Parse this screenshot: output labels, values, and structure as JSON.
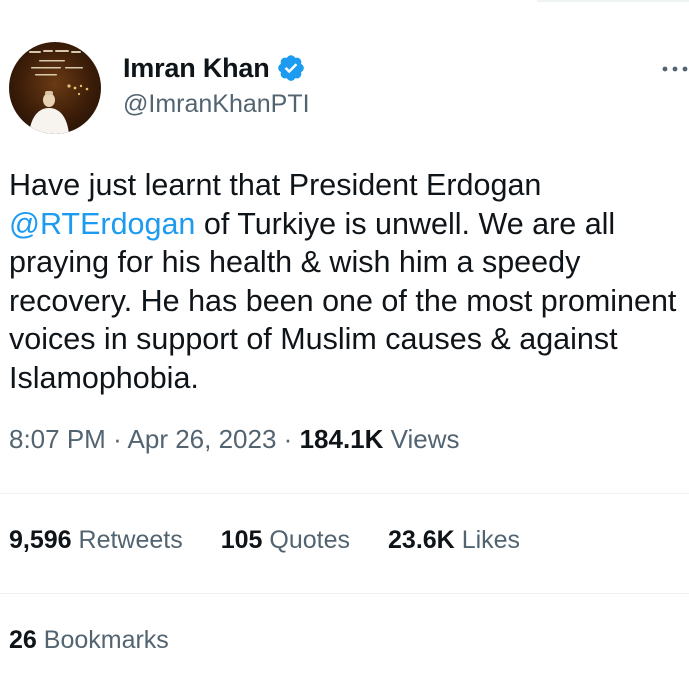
{
  "author": {
    "name": "Imran Khan",
    "handle": "@ImranKhanPTI",
    "verified_icon": "verified-badge-icon",
    "avatar_icon": "profile-avatar"
  },
  "tweet": {
    "text_before_mention": "Have just learnt that President Erdogan",
    "mention": "@RTErdogan",
    "text_after_mention": " of Turkiye is unwell. We are all praying for his health & wish him a speedy recovery. He has been one of the most prominent voices in support of Muslim causes & against Islamophobia."
  },
  "meta": {
    "time": "8:07 PM",
    "separator": "·",
    "date": "Apr 26, 2023",
    "views_count": "184.1K",
    "views_label": "Views"
  },
  "stats": {
    "retweets_count": "9,596",
    "retweets_label": "Retweets",
    "quotes_count": "105",
    "quotes_label": "Quotes",
    "likes_count": "23.6K",
    "likes_label": "Likes",
    "bookmarks_count": "26",
    "bookmarks_label": "Bookmarks"
  },
  "colors": {
    "accent": "#1d9bf0",
    "text_primary": "#0f1419",
    "text_secondary": "#536471",
    "divider": "#eff3f4"
  },
  "more_icon": "more-options-icon"
}
